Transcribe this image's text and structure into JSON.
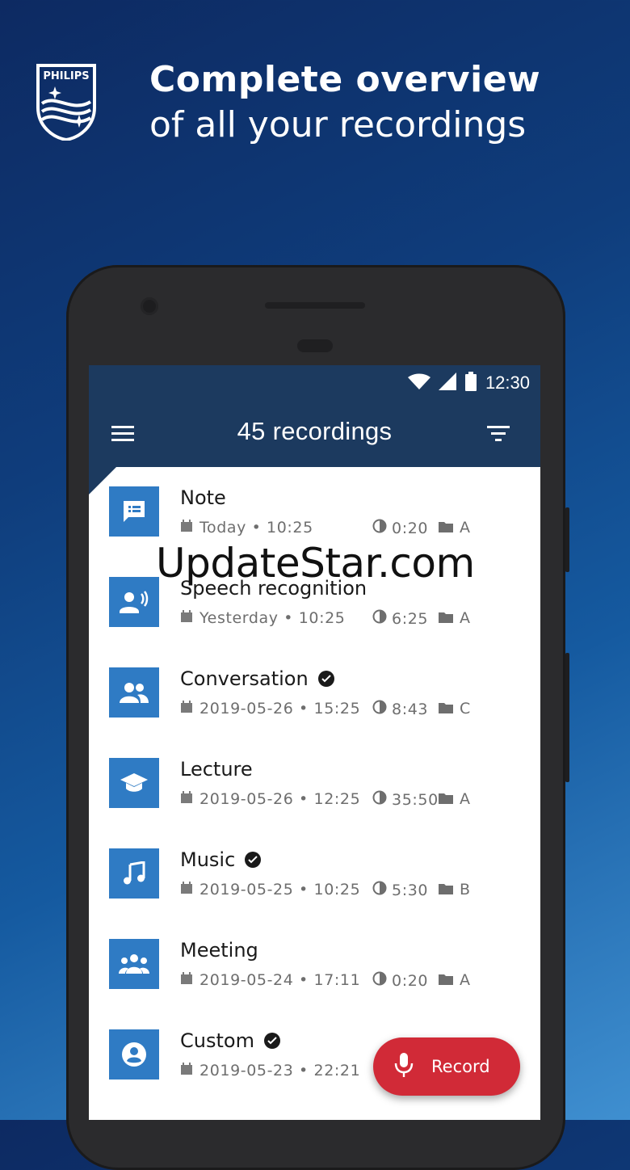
{
  "brand": {
    "logo_text": "PHILIPS"
  },
  "headline": {
    "line1": "Complete overview",
    "line2": "of all your recordings"
  },
  "status": {
    "time": "12:30"
  },
  "app_bar": {
    "title": "45 recordings"
  },
  "recordings": [
    {
      "name": "Note",
      "type_icon": "note-icon",
      "date": "Today • 10:25",
      "duration": "0:20",
      "folder": "A",
      "verified": false
    },
    {
      "name": "Speech recognition",
      "type_icon": "speech-recognition-icon",
      "date": "Yesterday • 10:25",
      "duration": "6:25",
      "folder": "A",
      "verified": false
    },
    {
      "name": "Conversation",
      "type_icon": "conversation-icon",
      "date": "2019-05-26 • 15:25",
      "duration": "8:43",
      "folder": "C",
      "verified": true
    },
    {
      "name": "Lecture",
      "type_icon": "lecture-icon",
      "date": "2019-05-26 • 12:25",
      "duration": "35:50",
      "folder": "A",
      "verified": false
    },
    {
      "name": "Music",
      "type_icon": "music-icon",
      "date": "2019-05-25 • 10:25",
      "duration": "5:30",
      "folder": "B",
      "verified": true
    },
    {
      "name": "Meeting",
      "type_icon": "meeting-icon",
      "date": "2019-05-24 • 17:11",
      "duration": "0:20",
      "folder": "A",
      "verified": false
    },
    {
      "name": "Custom",
      "type_icon": "custom-icon",
      "date": "2019-05-23 • 22:21",
      "duration": "",
      "folder": "",
      "verified": true
    }
  ],
  "record_button": {
    "label": "Record"
  },
  "watermark": {
    "text": "UpdateStar.com"
  },
  "colors": {
    "app_bar": "#1c3a5f",
    "thumb": "#2f7bc4",
    "record": "#d12a37"
  }
}
